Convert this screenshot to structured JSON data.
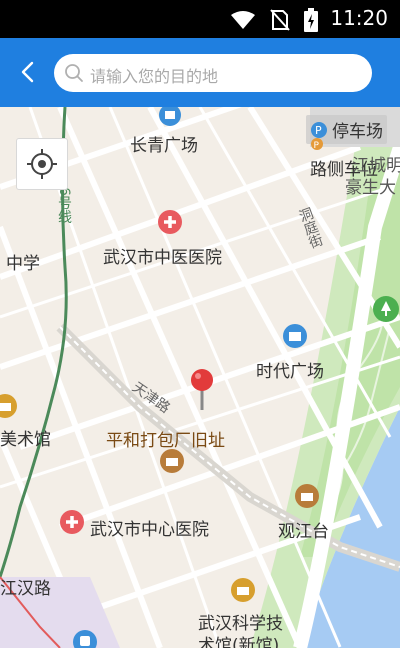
{
  "status_bar": {
    "time": "11:20",
    "icons": [
      "wifi-icon",
      "no-sim-icon",
      "battery-charging-icon"
    ]
  },
  "header": {
    "back_icon": "chevron-left-icon",
    "search_placeholder": "请输入您的目的地"
  },
  "colors": {
    "header_bg": "#1f7fe0",
    "map_bg": "#f3eee7",
    "water": "#a6cbf3",
    "park": "#c9e9b6",
    "hospital_red": "#e85a5f",
    "mall_blue": "#3b8fd9",
    "culture_brown": "#b87c3a",
    "marker_red": "#e23b3b"
  },
  "map": {
    "locate_icon": "crosshair-locate-icon",
    "pois": [
      {
        "label": "长青广场",
        "type": "mall"
      },
      {
        "label": "停车场",
        "type": "parking"
      },
      {
        "label": "路侧车位",
        "type": "parking"
      },
      {
        "label": "江城明",
        "type": "text"
      },
      {
        "label": "豪生大",
        "type": "text"
      },
      {
        "label": "武汉市中医医院",
        "type": "hospital"
      },
      {
        "label": "中学",
        "type": "text"
      },
      {
        "label": "时代广场",
        "type": "mall"
      },
      {
        "label": "美术馆",
        "type": "culture"
      },
      {
        "label": "平和打包厂旧址",
        "type": "culture"
      },
      {
        "label": "武汉市中心医院",
        "type": "hospital"
      },
      {
        "label": "观江台",
        "type": "culture"
      },
      {
        "label": "江汉路",
        "type": "text"
      },
      {
        "label": "武汉科学技",
        "type": "culture"
      },
      {
        "label": "术馆(新馆)",
        "type": "culture"
      }
    ],
    "streets": [
      "洞庭街",
      "天津路",
      "6号线"
    ]
  }
}
